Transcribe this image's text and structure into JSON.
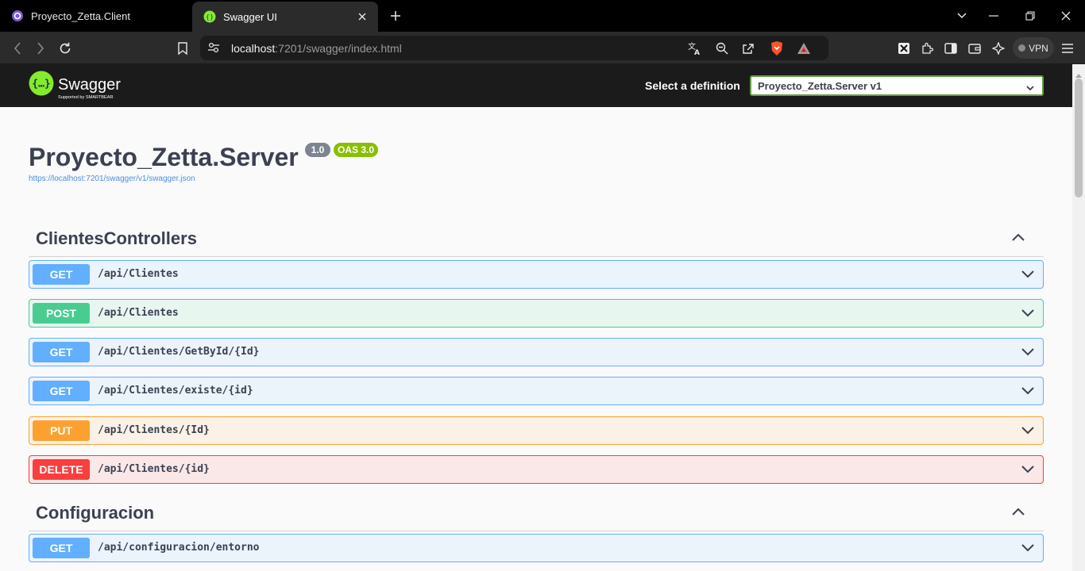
{
  "browser": {
    "tabs": [
      {
        "title": "Proyecto_Zetta.Client",
        "favicon": "blazor-icon"
      },
      {
        "title": "Swagger UI",
        "favicon": "swagger-icon"
      }
    ],
    "url_host": "localhost",
    "url_rest": ":7201/swagger/index.html",
    "vpn_label": "VPN"
  },
  "swagger": {
    "logo_text": "Swagger",
    "logo_sub": "Supported by SMARTBEAR",
    "definition_label": "Select a definition",
    "definition_selected": "Proyecto_Zetta.Server v1"
  },
  "info": {
    "title": "Proyecto_Zetta.Server",
    "version": "1.0",
    "oas": "OAS 3.0",
    "spec_url": "https://localhost:7201/swagger/v1/swagger.json"
  },
  "tags": [
    {
      "name": "ClientesControllers",
      "operations": [
        {
          "method": "GET",
          "path": "/api/Clientes"
        },
        {
          "method": "POST",
          "path": "/api/Clientes"
        },
        {
          "method": "GET",
          "path": "/api/Clientes/GetById/{Id}"
        },
        {
          "method": "GET",
          "path": "/api/Clientes/existe/{id}"
        },
        {
          "method": "PUT",
          "path": "/api/Clientes/{Id}"
        },
        {
          "method": "DELETE",
          "path": "/api/Clientes/{id}"
        }
      ]
    },
    {
      "name": "Configuracion",
      "operations": [
        {
          "method": "GET",
          "path": "/api/configuracion/entorno"
        }
      ]
    }
  ],
  "colors": {
    "get": "#61affe",
    "post": "#49cc90",
    "put": "#fca130",
    "delete": "#f93e3e",
    "swagger_green": "#85ea2d"
  }
}
